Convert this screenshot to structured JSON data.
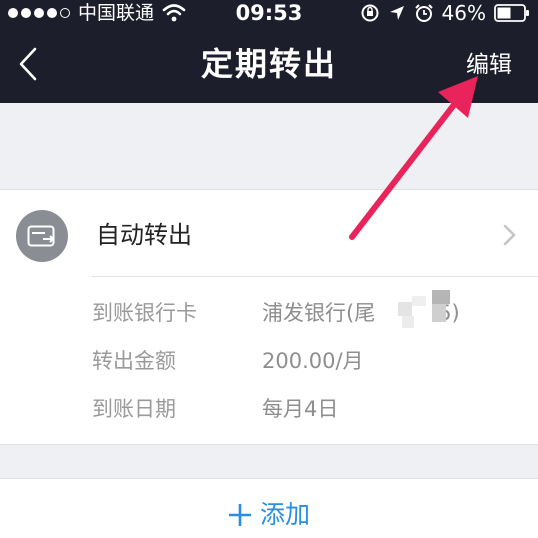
{
  "status_bar": {
    "carrier": "中国联通",
    "time": "09:53",
    "battery": "46%"
  },
  "nav": {
    "title": "定期转出",
    "edit_label": "编辑"
  },
  "plan": {
    "title": "自动转出",
    "details": [
      {
        "label": "到账银行卡",
        "value": "浦发银行(尾　　　5)"
      },
      {
        "label": "转出金额",
        "value": "200.00/月"
      },
      {
        "label": "到账日期",
        "value": "每月4日"
      }
    ]
  },
  "add": {
    "label": "添加"
  },
  "colors": {
    "nav_background": "#1c1e2c",
    "accent": "#2a8ee0",
    "annotation_arrow": "#e8245a"
  }
}
